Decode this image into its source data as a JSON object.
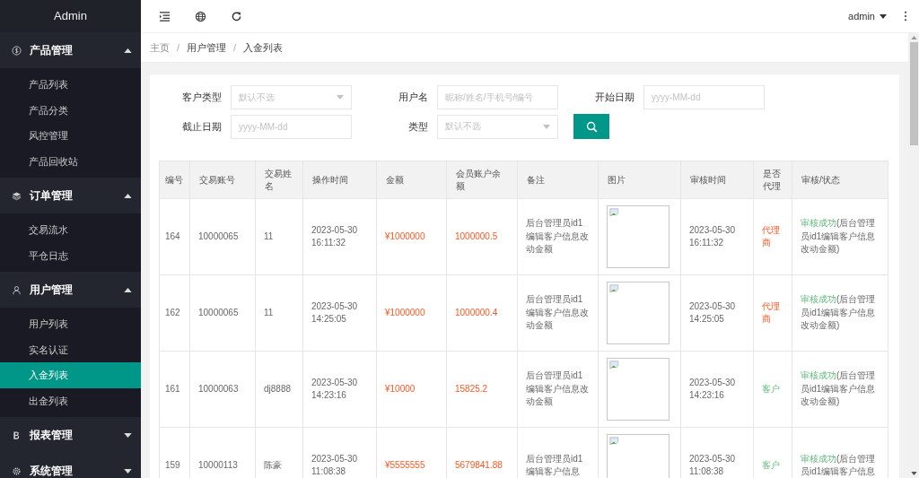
{
  "sidebar": {
    "title": "Admin",
    "groups": [
      {
        "label": "产品管理",
        "expanded": true,
        "items": [
          {
            "label": "产品列表",
            "selected": false
          },
          {
            "label": "产品分类",
            "selected": false
          },
          {
            "label": "风控管理",
            "selected": false
          },
          {
            "label": "产品回收站",
            "selected": false
          }
        ]
      },
      {
        "label": "订单管理",
        "expanded": true,
        "items": [
          {
            "label": "交易流水",
            "selected": false
          },
          {
            "label": "平仓日志",
            "selected": false
          }
        ]
      },
      {
        "label": "用户管理",
        "expanded": true,
        "items": [
          {
            "label": "用户列表",
            "selected": false
          },
          {
            "label": "实名认证",
            "selected": false
          },
          {
            "label": "入金列表",
            "selected": true
          },
          {
            "label": "出金列表",
            "selected": false
          }
        ]
      },
      {
        "label": "报表管理",
        "expanded": false
      },
      {
        "label": "系统管理",
        "expanded": false
      }
    ]
  },
  "topbar": {
    "user": "admin"
  },
  "breadcrumb": [
    {
      "label": "主页"
    },
    {
      "separator": "/",
      "label": "用户管理"
    },
    {
      "separator": "/",
      "label": "入金列表"
    }
  ],
  "filters": [
    {
      "kind": "select",
      "label": "客户类型",
      "placeholder": "默认不选"
    },
    {
      "kind": "input",
      "label": "用户名",
      "placeholder": "昵称/姓名/手机号/编号"
    },
    {
      "kind": "input",
      "label": "开始日期",
      "placeholder": "yyyy-MM-dd"
    },
    {
      "kind": "input",
      "label": "截止日期",
      "placeholder": "yyyy-MM-dd"
    },
    {
      "kind": "select",
      "label": "类型",
      "placeholder": "默认不选"
    }
  ],
  "table": {
    "columns": [
      "编号",
      "交易账号",
      "交易姓名",
      "操作时间",
      "金额",
      "会员账户余额",
      "备注",
      "图片",
      "审核时间",
      "是否代理",
      "审核/状态"
    ],
    "rows": [
      {
        "id": "164",
        "account": "10000065",
        "name": "11",
        "op_time": "2023-05-30 16:11:32",
        "amount": "¥1000000",
        "balance": "1000000.5",
        "note": "后台管理员id1编辑客户信息改动金额",
        "review_time": "2023-05-30 16:11:32",
        "agent": true,
        "agent_label": "代理商",
        "status_label": "审核成功",
        "status_note": "(后台管理员id1编辑客户信息改动金额)"
      },
      {
        "id": "162",
        "account": "10000065",
        "name": "11",
        "op_time": "2023-05-30 14:25:05",
        "amount": "¥1000000",
        "balance": "1000000.4",
        "note": "后台管理员id1编辑客户信息改动金额",
        "review_time": "2023-05-30 14:25:05",
        "agent": true,
        "agent_label": "代理商",
        "status_label": "审核成功",
        "status_note": "(后台管理员id1编辑客户信息改动金额)"
      },
      {
        "id": "161",
        "account": "10000063",
        "name": "dj8888",
        "op_time": "2023-05-30 14:23:16",
        "amount": "¥10000",
        "balance": "15825.2",
        "note": "后台管理员id1编辑客户信息改动金额",
        "review_time": "2023-05-30 14:23:16",
        "agent": false,
        "agent_label": "客户",
        "status_label": "审核成功",
        "status_note": "(后台管理员id1编辑客户信息改动金额)"
      },
      {
        "id": "159",
        "account": "10000113",
        "name": "陈豪",
        "op_time": "2023-05-30 11:08:38",
        "amount": "¥5555555",
        "balance": "5679841.88",
        "note": "后台管理员id1编辑客户信息",
        "review_time": "2023-05-30 11:08:38",
        "agent": false,
        "agent_label": "客户",
        "status_label": "审核成功",
        "status_note": "(后台管理员id1编辑客户信息"
      }
    ]
  }
}
